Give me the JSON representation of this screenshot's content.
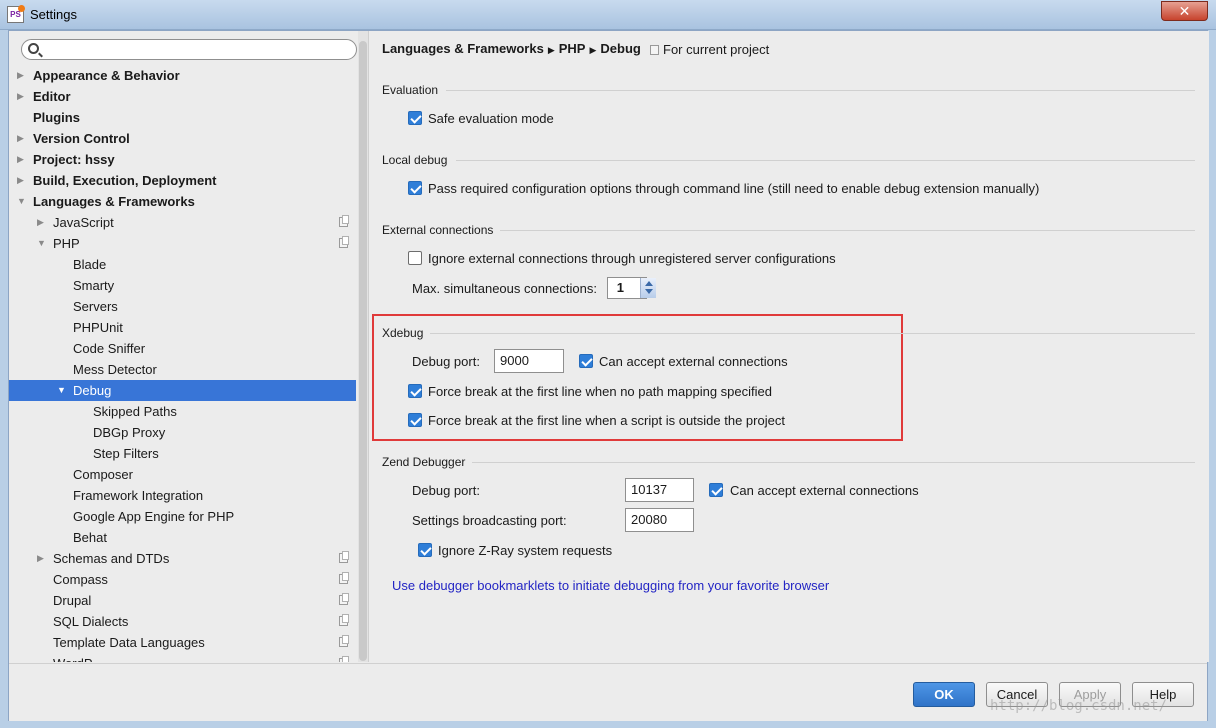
{
  "window": {
    "title": "Settings",
    "app_icon": "PS",
    "close_glyph": "✕"
  },
  "search": {
    "placeholder": "",
    "value": ""
  },
  "tree": [
    {
      "label": "Appearance & Behavior",
      "level": 0,
      "arrow": "▶",
      "bold": true
    },
    {
      "label": "Editor",
      "level": 0,
      "arrow": "▶",
      "bold": true
    },
    {
      "label": "Plugins",
      "level": 0,
      "arrow": "",
      "bold": true
    },
    {
      "label": "Version Control",
      "level": 0,
      "arrow": "▶",
      "bold": true
    },
    {
      "label": "Project: hssy",
      "level": 0,
      "arrow": "▶",
      "bold": true
    },
    {
      "label": "Build, Execution, Deployment",
      "level": 0,
      "arrow": "▶",
      "bold": true
    },
    {
      "label": "Languages & Frameworks",
      "level": 0,
      "arrow": "▼",
      "bold": true
    },
    {
      "label": "JavaScript",
      "level": 1,
      "arrow": "▶",
      "project_icon": true
    },
    {
      "label": "PHP",
      "level": 1,
      "arrow": "▼",
      "project_icon": true
    },
    {
      "label": "Blade",
      "level": 2,
      "arrow": ""
    },
    {
      "label": "Smarty",
      "level": 2,
      "arrow": ""
    },
    {
      "label": "Servers",
      "level": 2,
      "arrow": ""
    },
    {
      "label": "PHPUnit",
      "level": 2,
      "arrow": ""
    },
    {
      "label": "Code Sniffer",
      "level": 2,
      "arrow": ""
    },
    {
      "label": "Mess Detector",
      "level": 2,
      "arrow": ""
    },
    {
      "label": "Debug",
      "level": 2,
      "arrow": "▼",
      "selected": true
    },
    {
      "label": "Skipped Paths",
      "level": 3,
      "arrow": ""
    },
    {
      "label": "DBGp Proxy",
      "level": 3,
      "arrow": ""
    },
    {
      "label": "Step Filters",
      "level": 3,
      "arrow": ""
    },
    {
      "label": "Composer",
      "level": 2,
      "arrow": ""
    },
    {
      "label": "Framework Integration",
      "level": 2,
      "arrow": ""
    },
    {
      "label": "Google App Engine for PHP",
      "level": 2,
      "arrow": ""
    },
    {
      "label": "Behat",
      "level": 2,
      "arrow": ""
    },
    {
      "label": "Schemas and DTDs",
      "level": 1,
      "arrow": "▶",
      "project_icon": true
    },
    {
      "label": "Compass",
      "level": 1,
      "arrow": "",
      "project_icon": true
    },
    {
      "label": "Drupal",
      "level": 1,
      "arrow": "",
      "project_icon": true
    },
    {
      "label": "SQL Dialects",
      "level": 1,
      "arrow": "",
      "project_icon": true
    },
    {
      "label": "Template Data Languages",
      "level": 1,
      "arrow": "",
      "project_icon": true
    },
    {
      "label": "WordP",
      "level": 1,
      "arrow": "",
      "project_icon": true
    }
  ],
  "breadcrumb": {
    "part1": "Languages & Frameworks",
    "part2": "PHP",
    "part3": "Debug",
    "sep": "▶",
    "scope": "For current project"
  },
  "evaluation": {
    "title": "Evaluation",
    "safe_mode": {
      "label": "Safe evaluation mode",
      "checked": true
    }
  },
  "local_debug": {
    "title": "Local debug",
    "pass_options": {
      "label": "Pass required configuration options through command line (still need to enable debug extension manually)",
      "checked": true
    }
  },
  "external": {
    "title": "External connections",
    "ignore": {
      "label": "Ignore external connections through unregistered server configurations",
      "checked": false
    },
    "max_label": "Max. simultaneous connections:",
    "max_value": "1"
  },
  "xdebug": {
    "title": "Xdebug",
    "port_label": "Debug port:",
    "port_value": "9000",
    "accept": {
      "label": "Can accept external connections",
      "checked": true
    },
    "force_no_mapping": {
      "label": "Force break at the first line when no path mapping specified",
      "checked": true
    },
    "force_outside": {
      "label": "Force break at the first line when a script is outside the project",
      "checked": true
    }
  },
  "zend": {
    "title": "Zend Debugger",
    "port_label": "Debug port:",
    "port_value": "10137",
    "accept": {
      "label": "Can accept external connections",
      "checked": true
    },
    "broadcast_label": "Settings broadcasting port:",
    "broadcast_value": "20080",
    "zray": {
      "label": "Ignore Z-Ray system requests",
      "checked": true
    }
  },
  "link": "Use debugger bookmarklets to initiate debugging from your favorite browser",
  "buttons": {
    "ok": "OK",
    "cancel": "Cancel",
    "apply": "Apply",
    "help": "Help"
  },
  "watermark": "http://blog.csdn.net/",
  "colors": {
    "selection": "#3875d7",
    "checkbox": "#2f7ed8",
    "highlight_box": "#e03a3a",
    "link": "#2325c4",
    "ok_button": "#2f73c8"
  }
}
